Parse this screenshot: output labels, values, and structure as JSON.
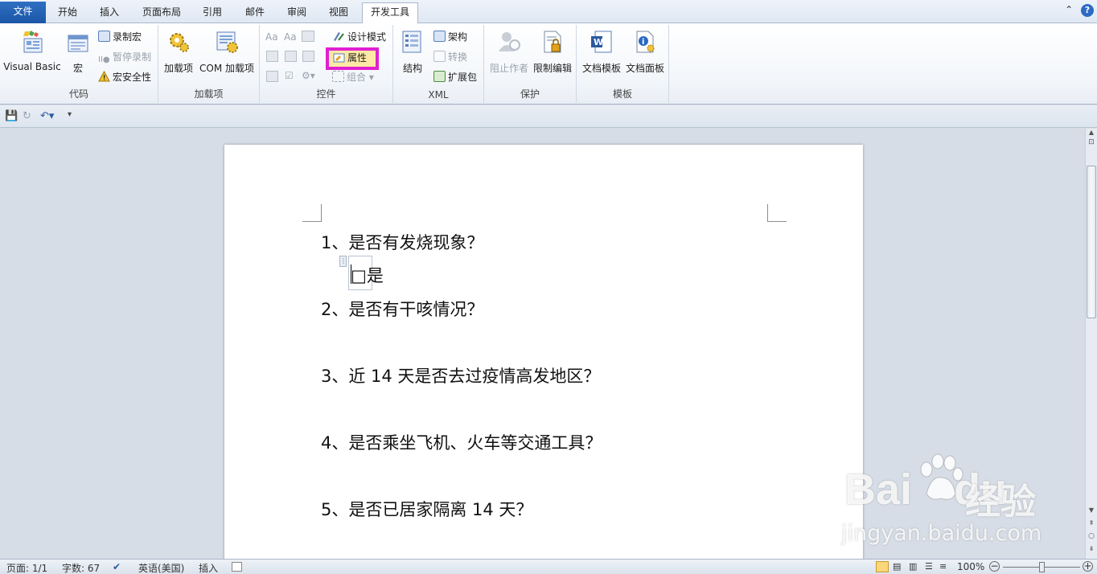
{
  "tabs": {
    "file": "文件",
    "home": "开始",
    "insert": "插入",
    "layout": "页面布局",
    "references": "引用",
    "mailings": "邮件",
    "review": "审阅",
    "view": "视图",
    "developer": "开发工具"
  },
  "ribbon": {
    "code": {
      "visual_basic": "Visual Basic",
      "macros": "宏",
      "record_macro": "录制宏",
      "pause_recording": "暂停录制",
      "macro_security": "宏安全性",
      "label": "代码"
    },
    "addins": {
      "addins": "加载项",
      "com_addins": "COM 加载项",
      "label": "加载项"
    },
    "controls": {
      "design_mode": "设计模式",
      "properties": "属性",
      "group": "组合",
      "label": "控件"
    },
    "xml": {
      "structure": "结构",
      "schema": "架构",
      "transform": "转换",
      "expansion_packs": "扩展包",
      "label": "XML"
    },
    "protect": {
      "block_authors": "阻止作者",
      "restrict_editing": "限制编辑",
      "label": "保护"
    },
    "templates": {
      "document_template": "文档模板",
      "document_panel": "文档面板",
      "label": "模板"
    }
  },
  "document": {
    "q1": "1、是否有发烧现象？",
    "checkbox_label": "□是",
    "q2": "2、是否有干咳情况？",
    "q3": "3、近 14 天是否去过疫情高发地区？",
    "q4": "4、是否乘坐飞机、火车等交通工具？",
    "q5": "5、是否已居家隔离 14 天？"
  },
  "status": {
    "page": "页面: 1/1",
    "words": "字数: 67",
    "language": "英语(美国)",
    "mode": "插入",
    "zoom": "100%"
  },
  "watermark": {
    "brand": "Bai",
    "brand2": "du",
    "jingyan": "经验",
    "url": "jingyan.baidu.com"
  },
  "colors": {
    "accent": "#1c56a6",
    "highlight_box": "#e020d0",
    "properties_bg": "#fde9a5"
  },
  "icons": [
    "visual-basic-icon",
    "macros-icon",
    "record-macro-icon",
    "pause-icon",
    "warning-icon",
    "gear-icon",
    "com-addins-icon",
    "design-mode-icon",
    "properties-icon",
    "structure-icon",
    "schema-icon",
    "transform-icon",
    "expansion-pack-icon",
    "block-authors-icon",
    "restrict-editing-icon",
    "document-template-icon",
    "document-panel-icon",
    "save-icon",
    "undo-icon",
    "redo-icon",
    "help-icon"
  ]
}
